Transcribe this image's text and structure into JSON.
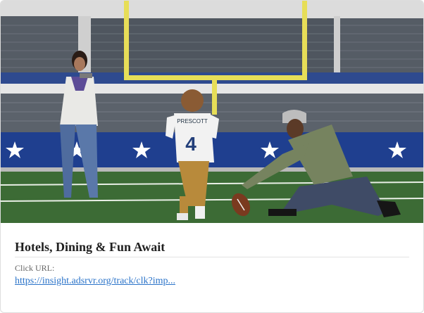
{
  "ad": {
    "title": "Hotels, Dining & Fun Await",
    "click_label": "Click URL:",
    "click_url": "https://insight.adsrvr.org/track/clk?imp...",
    "jersey_name": "PRESCOTT",
    "jersey_number": "4"
  },
  "colors": {
    "turf": "#3c6b35",
    "wall": "#1f3f8f",
    "seats": "#4d545d",
    "goalpost": "#e7de58",
    "link": "#2a73c9"
  }
}
